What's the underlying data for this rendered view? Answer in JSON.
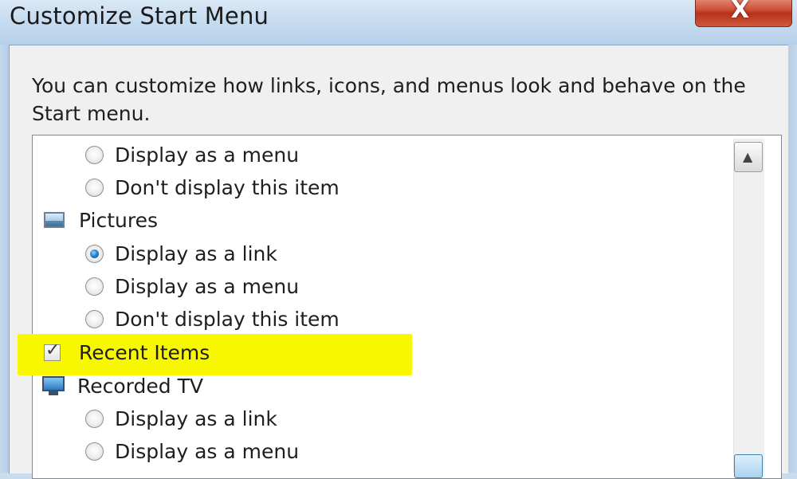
{
  "window": {
    "title": "Customize Start Menu",
    "close_glyph": "X"
  },
  "description": "You can customize how links, icons, and menus look and behave on the Start menu.",
  "list": {
    "items": [
      {
        "label": "Display as a menu",
        "type": "radio",
        "checked": false
      },
      {
        "label": "Don't display this item",
        "type": "radio",
        "checked": false
      },
      {
        "label": "Pictures",
        "type": "group",
        "icon": "pictures-icon"
      },
      {
        "label": "Display as a link",
        "type": "radio",
        "checked": true
      },
      {
        "label": "Display as a menu",
        "type": "radio",
        "checked": false
      },
      {
        "label": "Don't display this item",
        "type": "radio",
        "checked": false
      },
      {
        "label": "Recent Items",
        "type": "checkbox",
        "checked": true
      },
      {
        "label": "Recorded TV",
        "type": "group",
        "icon": "tv-icon"
      },
      {
        "label": "Display as a link",
        "type": "radio",
        "checked": false
      },
      {
        "label": "Display as a menu",
        "type": "radio",
        "checked": false
      }
    ]
  },
  "scrollbar": {
    "up_glyph": "▲"
  },
  "colors": {
    "highlight": "#f7f700",
    "close_button": "#c8432a",
    "titlebar": "#c7dcf0"
  }
}
